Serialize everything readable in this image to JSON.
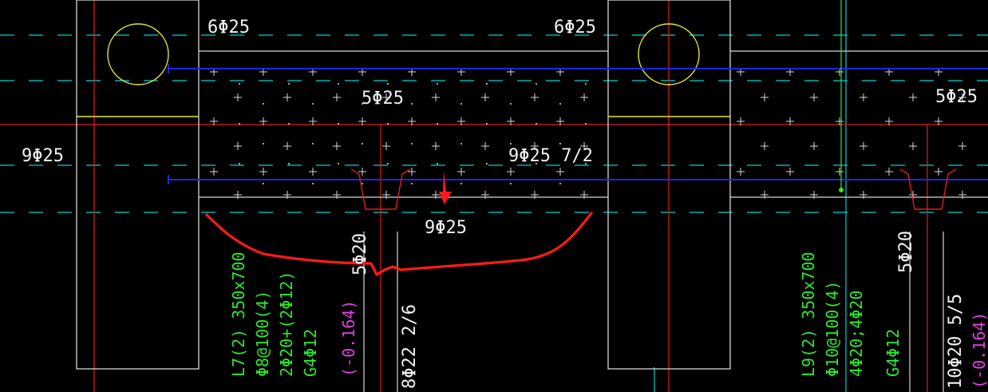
{
  "colors": {
    "background": "#000000",
    "outline": "#d8d8d8",
    "axis_red": "#e01e1e",
    "axis_cyan": "#00d2d2",
    "rebar_blue": "#1c28e0",
    "column_yellow": "#e6e632",
    "beam_label_green": "#2ee82e",
    "elevation_magenta": "#e040e0",
    "markup_red": "#ff1a1a"
  },
  "top_labels": {
    "left": "6Φ25",
    "middle": "6Φ25"
  },
  "middle_labels": {
    "left_top": "5Φ25",
    "right_top": "5Φ25",
    "left_side": "9Φ25",
    "span_bottom": "9Φ25 7/2",
    "below_beam": "9Φ25"
  },
  "beam_L7": {
    "name": "L7(2) 350x700",
    "stirrup": "Φ8@100(4)",
    "main_bars": "2Φ20+(2Φ12)",
    "side_bars": "G4Φ12",
    "elevation": "(-0.164)",
    "top_bars": "5Φ20",
    "bottom_bars": "8Φ22 2/6"
  },
  "beam_L9": {
    "name": "L9(2) 350x700",
    "stirrup": "Φ10@100(4)",
    "main_bars": "4Φ20;4Φ20",
    "side_bars": "G4Φ12",
    "elevation": "(-0.164)",
    "top_bars": "5Φ20",
    "bottom_bars": "10Φ20 5/5"
  }
}
